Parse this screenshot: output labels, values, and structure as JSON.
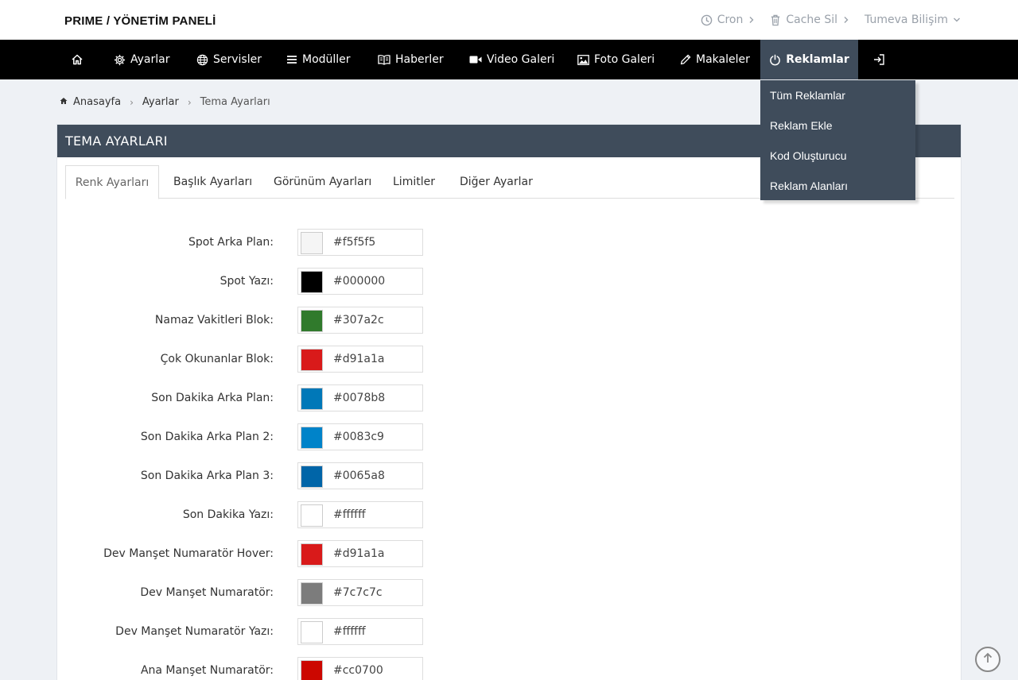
{
  "brand": "PRIME / YÖNETİM PANELİ",
  "top_links": [
    {
      "label": "Cron",
      "icon": "clock-icon"
    },
    {
      "label": "Cache Sil",
      "icon": "trash-icon"
    },
    {
      "label": "Tumeva Bilişim",
      "icon": "chevron-down-icon"
    }
  ],
  "nav": {
    "home_icon": "home-icon",
    "items": [
      {
        "label": "Ayarlar",
        "icon": "gear-icon"
      },
      {
        "label": "Servisler",
        "icon": "globe-icon"
      },
      {
        "label": "Modüller",
        "icon": "bars-icon"
      },
      {
        "label": "Haberler",
        "icon": "book-icon"
      },
      {
        "label": "Video Galeri",
        "icon": "video-icon"
      },
      {
        "label": "Foto Galeri",
        "icon": "image-icon"
      },
      {
        "label": "Makaleler",
        "icon": "pencil-icon"
      },
      {
        "label": "Reklamlar",
        "icon": "power-icon"
      }
    ],
    "logout_icon": "sign-in-icon"
  },
  "dropdown": {
    "items": [
      "Tüm Reklamlar",
      "Reklam Ekle",
      "Kod Oluşturucu",
      "Reklam Alanları"
    ]
  },
  "breadcrumb": {
    "home": "Anasayfa",
    "parent": "Ayarlar",
    "current": "Tema Ayarları"
  },
  "panel": {
    "title": "TEMA AYARLARI",
    "tabs": [
      "Renk Ayarları",
      "Başlık Ayarları",
      "Görünüm Ayarları",
      "Limitler",
      "Diğer Ayarlar"
    ]
  },
  "colors": [
    {
      "label": "Spot Arka Plan:",
      "value": "#f5f5f5"
    },
    {
      "label": "Spot Yazı:",
      "value": "#000000"
    },
    {
      "label": "Namaz Vakitleri Blok:",
      "value": "#307a2c"
    },
    {
      "label": "Çok Okunanlar Blok:",
      "value": "#d91a1a"
    },
    {
      "label": "Son Dakika Arka Plan:",
      "value": "#0078b8"
    },
    {
      "label": "Son Dakika Arka Plan 2:",
      "value": "#0083c9"
    },
    {
      "label": "Son Dakika Arka Plan 3:",
      "value": "#0065a8"
    },
    {
      "label": "Son Dakika Yazı:",
      "value": "#ffffff"
    },
    {
      "label": "Dev Manşet Numaratör Hover:",
      "value": "#d91a1a"
    },
    {
      "label": "Dev Manşet Numaratör:",
      "value": "#7c7c7c"
    },
    {
      "label": "Dev Manşet Numaratör Yazı:",
      "value": "#ffffff"
    },
    {
      "label": "Ana Manşet Numaratör:",
      "value": "#cc0700"
    }
  ],
  "theme": {
    "nav_bg": "#000000",
    "panel_head_bg": "#3f4c5b",
    "page_bg": "#eef1f5"
  }
}
